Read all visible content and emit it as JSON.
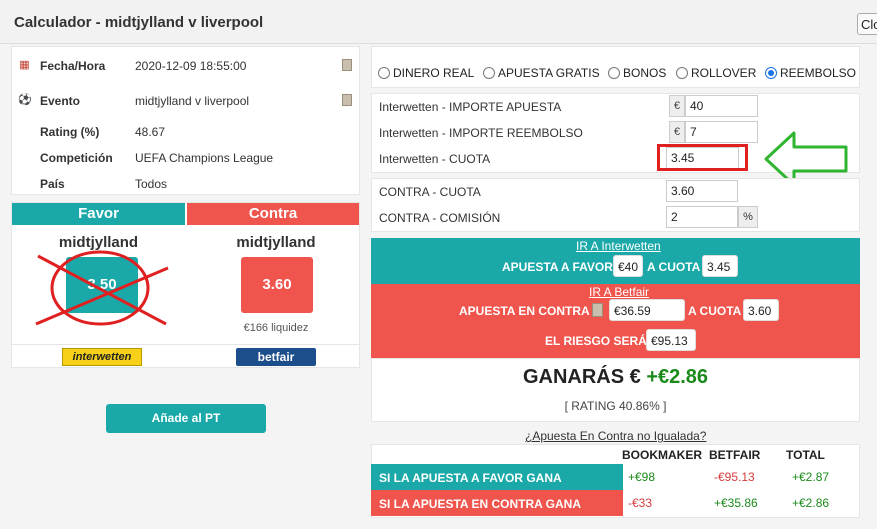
{
  "window": {
    "title": "Calculador - midtjylland v liverpool",
    "close_label": "Close"
  },
  "info": {
    "rows": [
      {
        "icon": "calendar-icon",
        "label": "Fecha/Hora",
        "value": "2020-12-09 18:55:00"
      },
      {
        "icon": "soccer-ball-icon",
        "label": "Evento",
        "value": "midtjylland v liverpool"
      },
      {
        "label": "Rating (%)",
        "value": "48.67"
      },
      {
        "label": "Competición",
        "value": "UEFA Champions League"
      },
      {
        "label": "País",
        "value": "Todos"
      }
    ]
  },
  "favor": {
    "header": "Favor",
    "team": "midtjylland",
    "odds": "3.50",
    "bookmaker": "interwetten"
  },
  "contra": {
    "header": "Contra",
    "team": "midtjylland",
    "odds": "3.60",
    "liquidity": "€166 liquidez",
    "exchange": "betfair"
  },
  "add_button": "Añade al PT",
  "modes": [
    {
      "label": "DINERO REAL",
      "selected": false
    },
    {
      "label": "APUESTA GRATIS",
      "selected": false
    },
    {
      "label": "BONOS",
      "selected": false
    },
    {
      "label": "ROLLOVER",
      "selected": false
    },
    {
      "label": "REEMBOLSO",
      "selected": true
    }
  ],
  "form": {
    "importe_apuesta_label": "Interwetten - IMPORTE APUESTA",
    "importe_apuesta": "40",
    "importe_reembolso_label": "Interwetten - IMPORTE REEMBOLSO",
    "importe_reembolso": "7",
    "cuota_label": "Interwetten - CUOTA",
    "cuota": "3.45",
    "contra_cuota_label": "CONTRA - CUOTA",
    "contra_cuota": "3.60",
    "contra_comision_label": "CONTRA - COMISIÓN",
    "contra_comision": "2",
    "currency": "€",
    "percent": "%"
  },
  "favor_band": {
    "link": "IR A Interwetten",
    "bet_label": "APUESTA A FAVOR",
    "bet_amount": "€40",
    "odds_label": "A CUOTA",
    "odds": "3.45"
  },
  "contra_band": {
    "link": "IR A Betfair",
    "bet_label": "APUESTA EN CONTRA",
    "bet_amount": "€36.59",
    "odds_label": "A CUOTA",
    "odds": "3.60",
    "risk_label": "EL RIESGO SERÁ",
    "risk": "€95.13"
  },
  "result": {
    "label": "GANARÁS €",
    "amount": "+€2.86",
    "rating": "[ RATING 40.86% ]"
  },
  "unmatched_link": "¿Apuesta En Contra no Igualada?",
  "table": {
    "headers": [
      "BOOKMAKER",
      "BETFAIR",
      "TOTAL"
    ],
    "rows": [
      {
        "label": "SI LA APUESTA A FAVOR GANA",
        "bookmaker": "+€98",
        "betfair": "-€95.13",
        "total": "+€2.87"
      },
      {
        "label": "SI LA APUESTA EN CONTRA GANA",
        "bookmaker": "-€33",
        "betfair": "+€35.86",
        "total": "+€2.86"
      }
    ]
  },
  "colors": {
    "teal": "#1aa8a8",
    "red": "#f0554d",
    "annotation_red": "#e02020",
    "arrow_green": "#2fb52f"
  }
}
